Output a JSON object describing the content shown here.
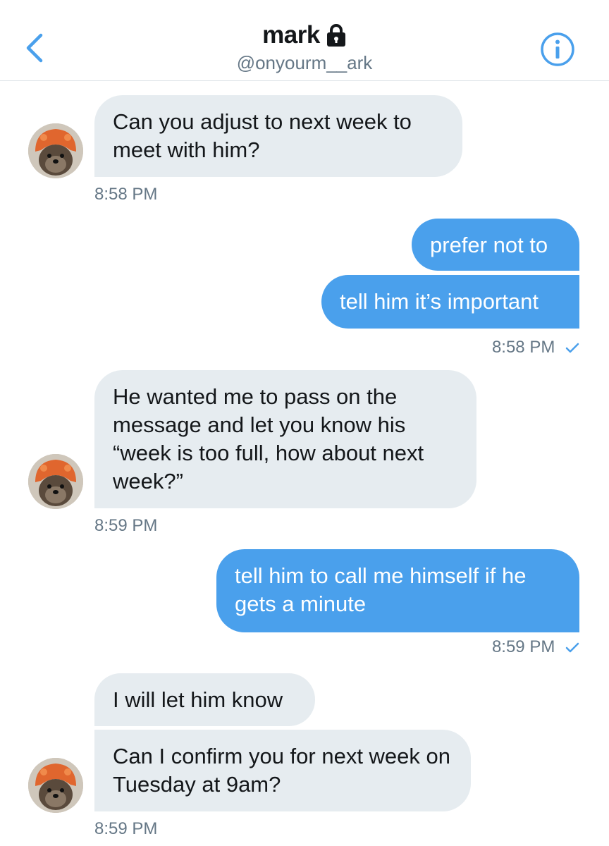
{
  "header": {
    "title": "mark",
    "handle": "@onyourm__ark",
    "back_icon": "chevron-left-icon",
    "lock_icon": "lock-icon",
    "info_icon": "info-icon",
    "accent": "#4aa0ec"
  },
  "messages": [
    {
      "text": "Can you adjust to next week to meet with him?"
    },
    {
      "text": "prefer not to"
    },
    {
      "text": "tell him it’s important"
    },
    {
      "text": "He wanted me to pass on the message and let you know his “week is too full, how about next week?”"
    },
    {
      "text": "tell him to call me himself if he gets a minute"
    },
    {
      "text": "I will let him know"
    },
    {
      "text": "Can I confirm you for next week on Tuesday at 9am?"
    }
  ],
  "timestamps": [
    {
      "text": "8:58 PM"
    },
    {
      "text": "8:58 PM"
    },
    {
      "text": "8:59 PM"
    },
    {
      "text": "8:59 PM"
    },
    {
      "text": "8:59 PM"
    }
  ],
  "colors": {
    "incoming_bubble": "#e6ecf0",
    "outgoing_bubble": "#4aa0ec",
    "timestamp": "#657786"
  }
}
